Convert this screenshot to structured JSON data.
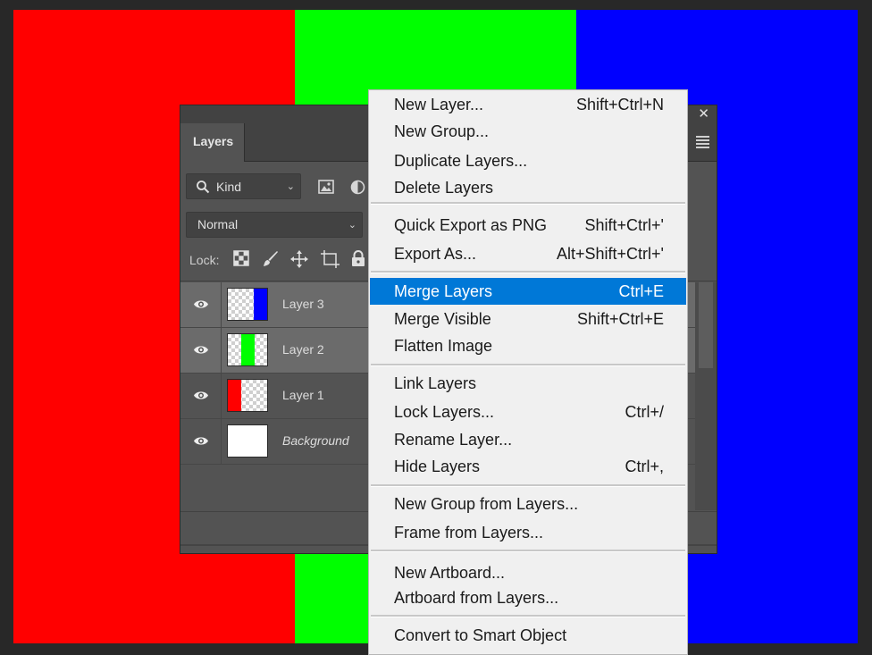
{
  "canvas": {
    "colors": [
      "#ff0000",
      "#00ff00",
      "#0000ff"
    ]
  },
  "panel": {
    "tab_label": "Layers",
    "filter": {
      "kind_label": "Kind"
    },
    "blend_mode": "Normal",
    "lock_label": "Lock:",
    "layers": [
      {
        "name": "Layer 3",
        "selected": true,
        "thumb_color": "#0000ff"
      },
      {
        "name": "Layer 2",
        "selected": true,
        "thumb_color": "#00ff00"
      },
      {
        "name": "Layer 1",
        "selected": false,
        "thumb_color": "#ff0000"
      },
      {
        "name": "Background",
        "selected": false,
        "thumb_color": "#ffffff"
      }
    ]
  },
  "menu": {
    "highlight_color": "#0078d7",
    "groups": [
      [
        {
          "label": "New Layer...",
          "shortcut": "Shift+Ctrl+N"
        },
        {
          "label": "New Group...",
          "shortcut": ""
        },
        {
          "label": "Duplicate Layers...",
          "shortcut": ""
        },
        {
          "label": "Delete Layers",
          "shortcut": ""
        }
      ],
      [
        {
          "label": "Quick Export as PNG",
          "shortcut": "Shift+Ctrl+'"
        },
        {
          "label": "Export As...",
          "shortcut": "Alt+Shift+Ctrl+'"
        }
      ],
      [
        {
          "label": "Merge Layers",
          "shortcut": "Ctrl+E",
          "highlighted": true
        },
        {
          "label": "Merge Visible",
          "shortcut": "Shift+Ctrl+E"
        },
        {
          "label": "Flatten Image",
          "shortcut": ""
        }
      ],
      [
        {
          "label": "Link Layers",
          "shortcut": ""
        },
        {
          "label": "Lock Layers...",
          "shortcut": "Ctrl+/"
        },
        {
          "label": "Rename Layer...",
          "shortcut": ""
        },
        {
          "label": "Hide Layers",
          "shortcut": "Ctrl+,"
        }
      ],
      [
        {
          "label": "New Group from Layers...",
          "shortcut": ""
        },
        {
          "label": "Frame from Layers...",
          "shortcut": ""
        }
      ],
      [
        {
          "label": "New Artboard...",
          "shortcut": ""
        },
        {
          "label": "Artboard from Layers...",
          "shortcut": ""
        }
      ],
      [
        {
          "label": "Convert to Smart Object",
          "shortcut": ""
        }
      ]
    ]
  }
}
